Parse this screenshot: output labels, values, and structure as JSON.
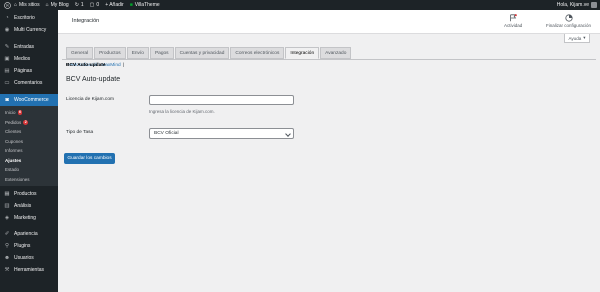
{
  "adminbar": {
    "my_sites": "Mis sitios",
    "blog": "My Blog",
    "updates": "1",
    "comments": "0",
    "add_new": "+ Añadir",
    "theme": "VillaTheme",
    "greeting": "Hola, Kijam.ve"
  },
  "sidebar": {
    "items_top": [
      {
        "label": "Escritorio",
        "icon": "dashboard-icon"
      },
      {
        "label": "Multi Currency",
        "icon": "currency-icon"
      }
    ],
    "items_mid": [
      {
        "label": "Entradas",
        "icon": "pin-icon"
      },
      {
        "label": "Medios",
        "icon": "media-icon"
      },
      {
        "label": "Páginas",
        "icon": "pages-icon"
      },
      {
        "label": "Comentarios",
        "icon": "comments-icon"
      }
    ],
    "woocommerce": "WooCommerce",
    "woo_sub": [
      {
        "label": "Inicio",
        "badge": "6"
      },
      {
        "label": "Pedidos",
        "badge": "2"
      },
      {
        "label": "Clientes"
      },
      {
        "label": "Cupones"
      },
      {
        "label": "Informes"
      },
      {
        "label": "Ajustes"
      },
      {
        "label": "Estado"
      },
      {
        "label": "Extensiones"
      }
    ],
    "items_bottom": [
      {
        "label": "Productos",
        "icon": "products-icon"
      },
      {
        "label": "Análisis",
        "icon": "analytics-icon"
      },
      {
        "label": "Marketing",
        "icon": "marketing-icon"
      },
      {
        "label": "Apariencia",
        "icon": "appearance-icon"
      },
      {
        "label": "Plugins",
        "icon": "plugins-icon"
      },
      {
        "label": "Usuarios",
        "icon": "users-icon"
      },
      {
        "label": "Herramientas",
        "icon": "tools-icon"
      }
    ]
  },
  "wcbar": {
    "title": "Integración",
    "activity": "Actividad",
    "finish": "Finalizar configuración",
    "help": "Ayuda"
  },
  "tabs": [
    "General",
    "Productos",
    "Envío",
    "Pagos",
    "Cuentas y privacidad",
    "Correos electrónicos",
    "Integración",
    "Avanzado"
  ],
  "active_tab": "Integración",
  "subsub": {
    "link": "Geolocalización MaxMind",
    "sep": "|",
    "current": "BCV Auto-update"
  },
  "form": {
    "section_title": "BCV Auto-update",
    "license_label": "Licencia de Kijam.com",
    "license_value": "",
    "license_desc": "Ingresa la licencia de Kijam.com.",
    "rate_label": "Tipo de Tasa",
    "rate_selected": "BCV Oficial",
    "save_label": "Guardar los cambios"
  },
  "colors": {
    "accent": "#2271b1",
    "sidebar": "#1d2327",
    "badge": "#d63638"
  }
}
